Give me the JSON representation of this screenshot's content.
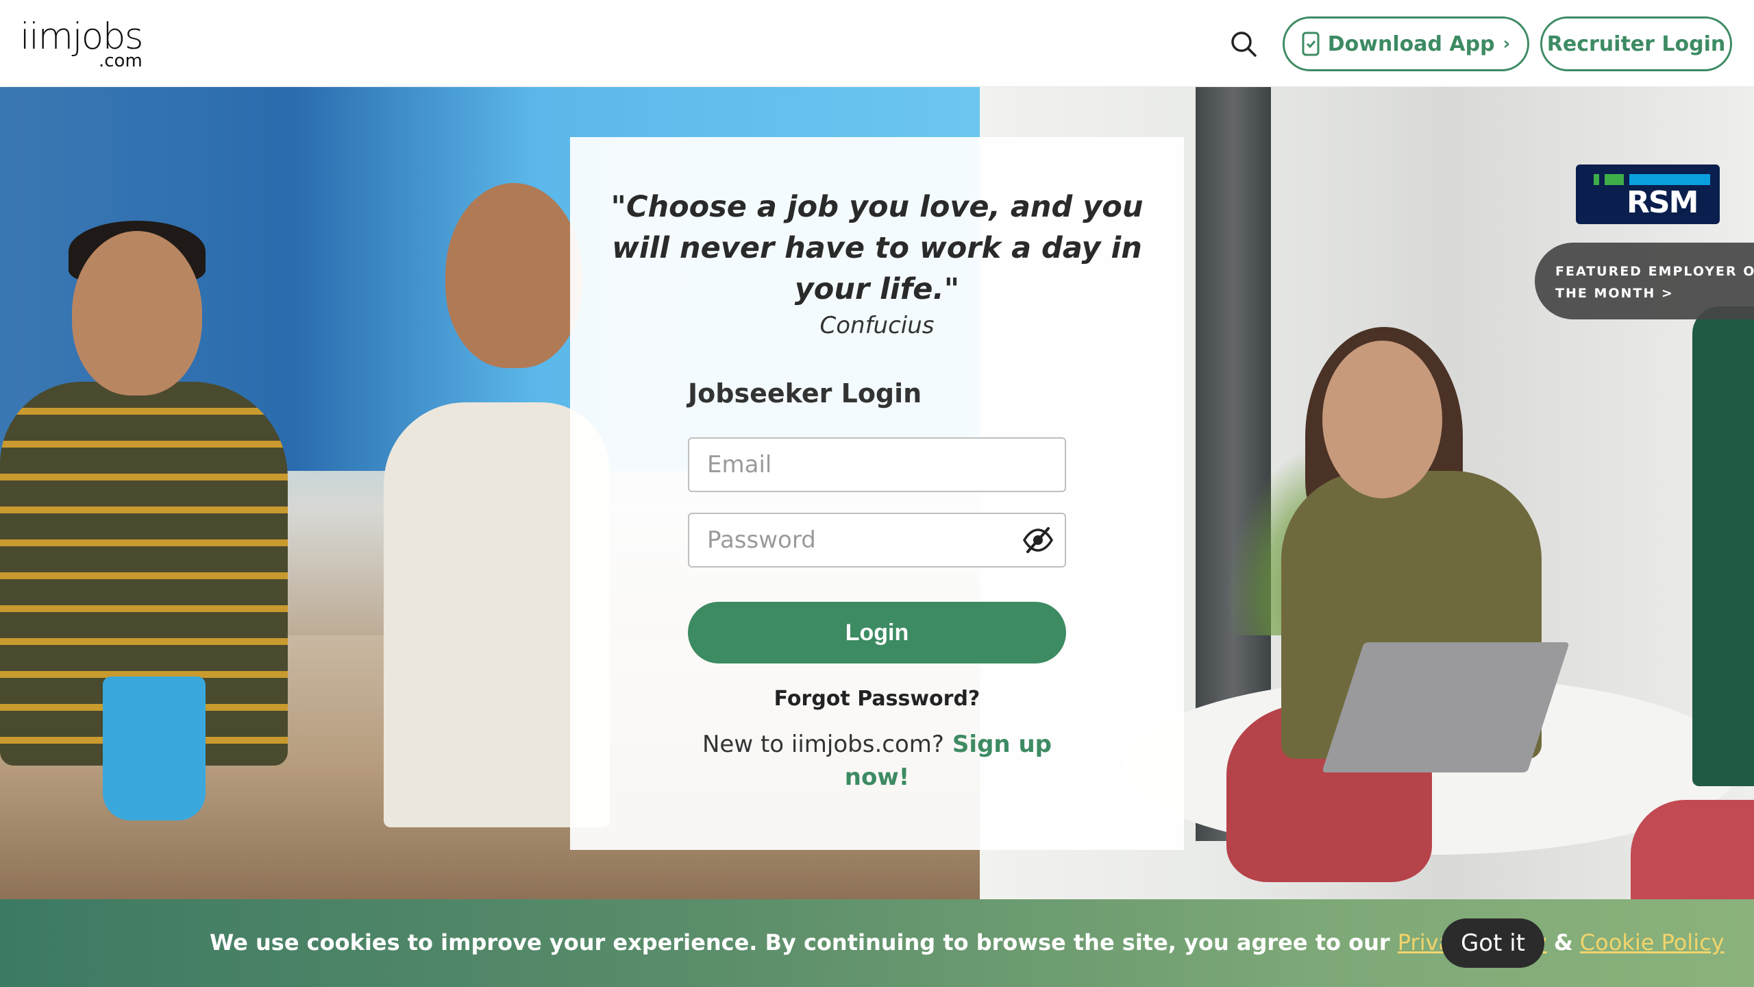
{
  "header": {
    "logo_main": "iimjobs",
    "logo_sub": ".com",
    "download_label": "Download App",
    "recruiter_label": "Recruiter Login"
  },
  "login": {
    "quote": "\"Choose a job you love, and you will never have to work a day in your life.\"",
    "author": "Confucius",
    "title": "Jobseeker Login",
    "email_placeholder": "Email",
    "password_placeholder": "Password",
    "login_label": "Login",
    "forgot_label": "Forgot Password?",
    "signup_prompt": "New to iimjobs.com?",
    "signup_link": "Sign up now!"
  },
  "featured": {
    "company": "RSM",
    "label": "FEATURED EMPLOYER OF THE MONTH >"
  },
  "cookie": {
    "text": "We use cookies to improve your experience. By continuing to browse the site, you agree to our",
    "privacy_link": "Privacy Policy",
    "ampersand": "&",
    "cookie_link": "Cookie Policy",
    "accept_label": "Got it"
  },
  "colors": {
    "accent": "#3d8b63",
    "link_yellow": "#f2d46b",
    "dark_button": "#2b2b2b"
  },
  "icons": [
    "search-icon",
    "phone-icon",
    "chevron-right-icon",
    "eye-slash-icon"
  ]
}
